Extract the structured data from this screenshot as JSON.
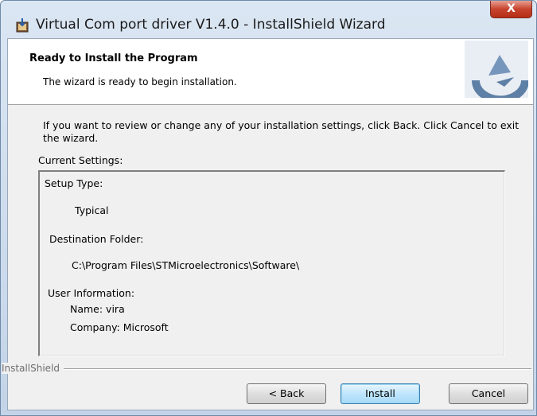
{
  "window": {
    "title": "Virtual Com port driver V1.4.0 - InstallShield Wizard",
    "close_label": "X",
    "icon": "installer-icon"
  },
  "header": {
    "title": "Ready to Install the Program",
    "subtitle": "The wizard is ready to begin installation.",
    "logo_icon": "installshield-logo-icon"
  },
  "body": {
    "intro": "If you want to review or change any of your installation settings, click Back. Click Cancel to exit the wizard.",
    "settings_label": "Current Settings:"
  },
  "settings": {
    "setup_type_label": "Setup Type:",
    "setup_type_value": "Typical",
    "destination_label": "Destination Folder:",
    "destination_value": "C:\\Program Files\\STMicroelectronics\\Software\\",
    "user_info_label": "User Information:",
    "user_name": "Name: vira",
    "user_company": "Company: Microsoft"
  },
  "footer": {
    "brand": "InstallShield",
    "back_label": "< Back",
    "install_label": "Install",
    "cancel_label": "Cancel"
  },
  "colors": {
    "close_button": "#c7432d",
    "default_button_border": "#3c7fb1",
    "logo": "#4f6f94"
  }
}
